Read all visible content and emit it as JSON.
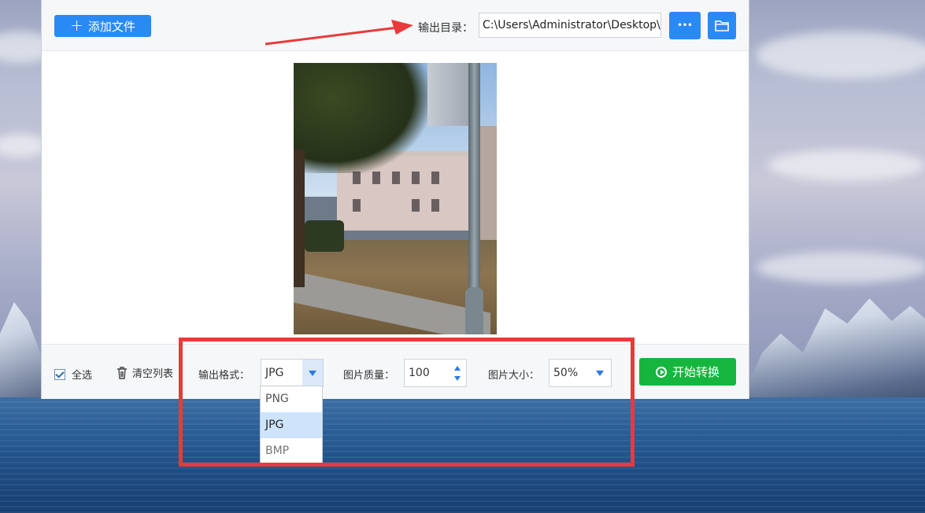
{
  "colors": {
    "accent_blue": "#2a8af5",
    "start_green": "#15b53e",
    "annotation_red": "#e83a3a"
  },
  "toolbar": {
    "add_files_label": "添加文件",
    "output_dir_label": "输出目录：",
    "output_dir_value": "C:\\Users\\Administrator\\Desktop\\",
    "more_label": "•••"
  },
  "bottombar": {
    "select_all_label": "全选",
    "clear_list_label": "清空列表",
    "format_label": "输出格式：",
    "format_value": "JPG",
    "quality_label": "图片质量：",
    "quality_value": "100",
    "size_label": "图片大小：",
    "size_value": "50%",
    "start_label": "开始转换"
  },
  "format_options": [
    "PNG",
    "JPG",
    "BMP"
  ],
  "selected_format": "JPG",
  "icons": {
    "add": "plus-icon",
    "more": "ellipsis-icon",
    "folder": "folder-icon",
    "checkbox": "checkbox-checked-icon",
    "trash": "trash-icon",
    "dropdown": "chevron-down-icon",
    "spinner_up": "spinner-up-icon",
    "spinner_down": "spinner-down-icon",
    "play": "play-circle-icon",
    "annotation_arrow": "red-arrow-icon"
  }
}
